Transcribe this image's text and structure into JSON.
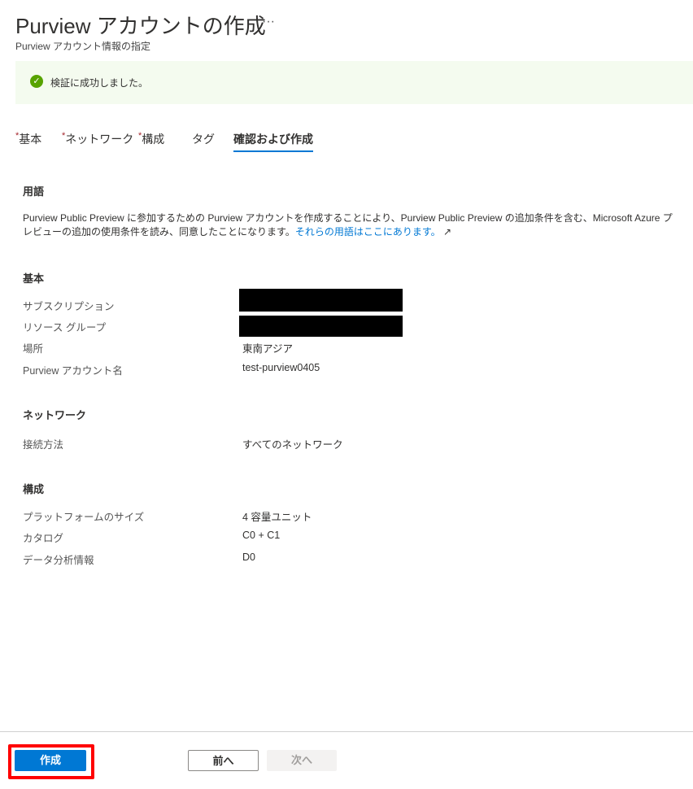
{
  "header": {
    "title": "Purview アカウントの作成",
    "more": "···",
    "subtitle": "Purview アカウント情報の指定"
  },
  "banner": {
    "icon": "check-circle-icon",
    "text": "検証に成功しました。"
  },
  "tabs": [
    {
      "label": "基本",
      "required": true
    },
    {
      "label": "ネットワーク",
      "required": true
    },
    {
      "label": "構成",
      "required": true
    },
    {
      "label": "タグ",
      "required": false
    },
    {
      "label": "確認および作成",
      "required": false,
      "active": true
    }
  ],
  "required_mark": "*",
  "terms": {
    "heading": "用語",
    "text": "Purview Public Preview に参加するための Purview アカウントを作成することにより、Purview Public Preview の追加条件を含む、Microsoft Azure プレビューの追加の使用条件を読み、同意したことになります。",
    "link": "それらの用語はここにあります。",
    "link_icon": "external-link-icon"
  },
  "basics": {
    "heading": "基本",
    "rows": [
      {
        "label": "サブスクリプション",
        "value": ""
      },
      {
        "label": "リソース グループ",
        "value": ""
      },
      {
        "label": "場所",
        "value": "東南アジア"
      },
      {
        "label": "Purview アカウント名",
        "value": "test-purview0405"
      }
    ]
  },
  "network": {
    "heading": "ネットワーク",
    "rows": [
      {
        "label": "接続方法",
        "value": "すべてのネットワーク"
      }
    ]
  },
  "config": {
    "heading": "構成",
    "rows": [
      {
        "label": "プラットフォームのサイズ",
        "value": "4 容量ユニット"
      },
      {
        "label": "カタログ",
        "value": "C0 + C1"
      },
      {
        "label": "データ分析情報",
        "value": "D0"
      }
    ]
  },
  "footer": {
    "create": "作成",
    "prev": "前へ",
    "next": "次へ"
  },
  "colors": {
    "accent": "#0078d4",
    "success": "#57a300",
    "highlight": "#ff0000"
  }
}
